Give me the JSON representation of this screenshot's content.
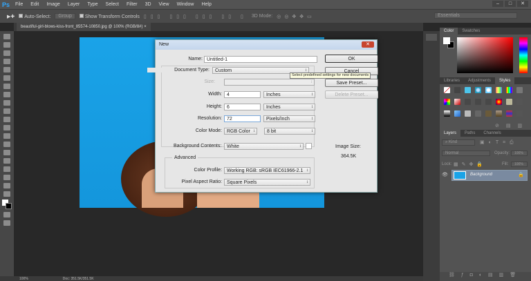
{
  "app": {
    "logo": "Ps",
    "menu": [
      "File",
      "Edit",
      "Image",
      "Layer",
      "Type",
      "Select",
      "Filter",
      "3D",
      "View",
      "Window",
      "Help"
    ],
    "window_controls": [
      "–",
      "□",
      "✕"
    ]
  },
  "options": {
    "auto_select": "Auto-Select:",
    "group": "Group",
    "show_transform": "Show Transform Controls",
    "mode_3d": "3D Mode:",
    "workspace": "Essentials"
  },
  "document_tab": {
    "title": "beautiful-girl-blows-kiss-front_85574-10850.jpg @ 100% (RGB/8#)",
    "close": "×"
  },
  "status": {
    "zoom": "100%",
    "doc": "Doc: 351.5K/351.5K"
  },
  "panels": {
    "color_tabs": [
      "Color",
      "Swatches"
    ],
    "styles_tabs": [
      "Libraries",
      "Adjustments",
      "Styles"
    ],
    "layers_tabs": [
      "Layers",
      "Paths",
      "Channels"
    ],
    "kind": "Kind",
    "blend": "Normal",
    "opacity_label": "Opacity:",
    "opacity": "100%",
    "lock_label": "Lock:",
    "fill_label": "Fill:",
    "fill": "100%",
    "layer_name": "Background"
  },
  "dialog": {
    "title": "New",
    "close": "✕",
    "name_label": "Name:",
    "name_value": "Untitled-1",
    "doctype_label": "Document Type:",
    "doctype_value": "Custom",
    "size_label": "Size:",
    "width_label": "Width:",
    "width_value": "4",
    "width_unit": "Inches",
    "height_label": "Height:",
    "height_value": "6",
    "height_unit": "Inches",
    "resolution_label": "Resolution:",
    "resolution_value": "72",
    "resolution_unit": "Pixels/Inch",
    "colormode_label": "Color Mode:",
    "colormode_value": "RGB Color",
    "bitdepth": "8 bit",
    "bg_label": "Background Contents:",
    "bg_value": "White",
    "advanced": "Advanced",
    "profile_label": "Color Profile:",
    "profile_value": "Working RGB:  sRGB IEC61966-2.1",
    "par_label": "Pixel Aspect Ratio:",
    "par_value": "Square Pixels",
    "ok": "OK",
    "cancel": "Cancel",
    "save_preset": "Save Preset...",
    "delete_preset": "Delete Preset...",
    "image_size_label": "Image Size:",
    "image_size": "364.5K",
    "tooltip": "Select predefined settings for new documents"
  }
}
